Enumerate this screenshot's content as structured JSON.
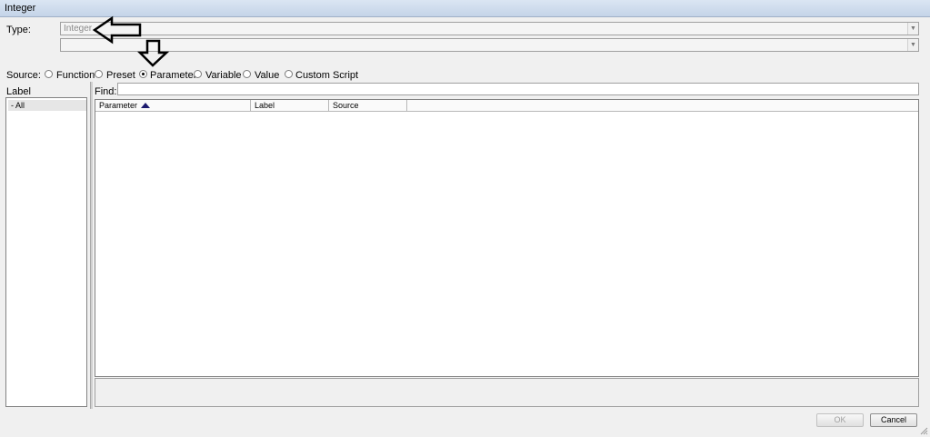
{
  "window": {
    "title": "Integer"
  },
  "type_row": {
    "label": "Type:",
    "value": "Integer",
    "second_value": ""
  },
  "source": {
    "label": "Source:",
    "options": [
      "Function",
      "Preset",
      "Parameter",
      "Variable",
      "Value",
      "Custom Script"
    ],
    "selected": "Parameter"
  },
  "left_panel": {
    "label": "Label",
    "items": [
      "- All"
    ]
  },
  "find": {
    "label": "Find:",
    "value": ""
  },
  "table": {
    "columns": [
      "Parameter",
      "Label",
      "Source"
    ],
    "sort_column": "Parameter",
    "sort_direction": "ascending",
    "rows": []
  },
  "buttons": {
    "ok": "OK",
    "cancel": "Cancel"
  },
  "annotations": [
    "left-arrow-outline",
    "down-arrow-outline"
  ]
}
